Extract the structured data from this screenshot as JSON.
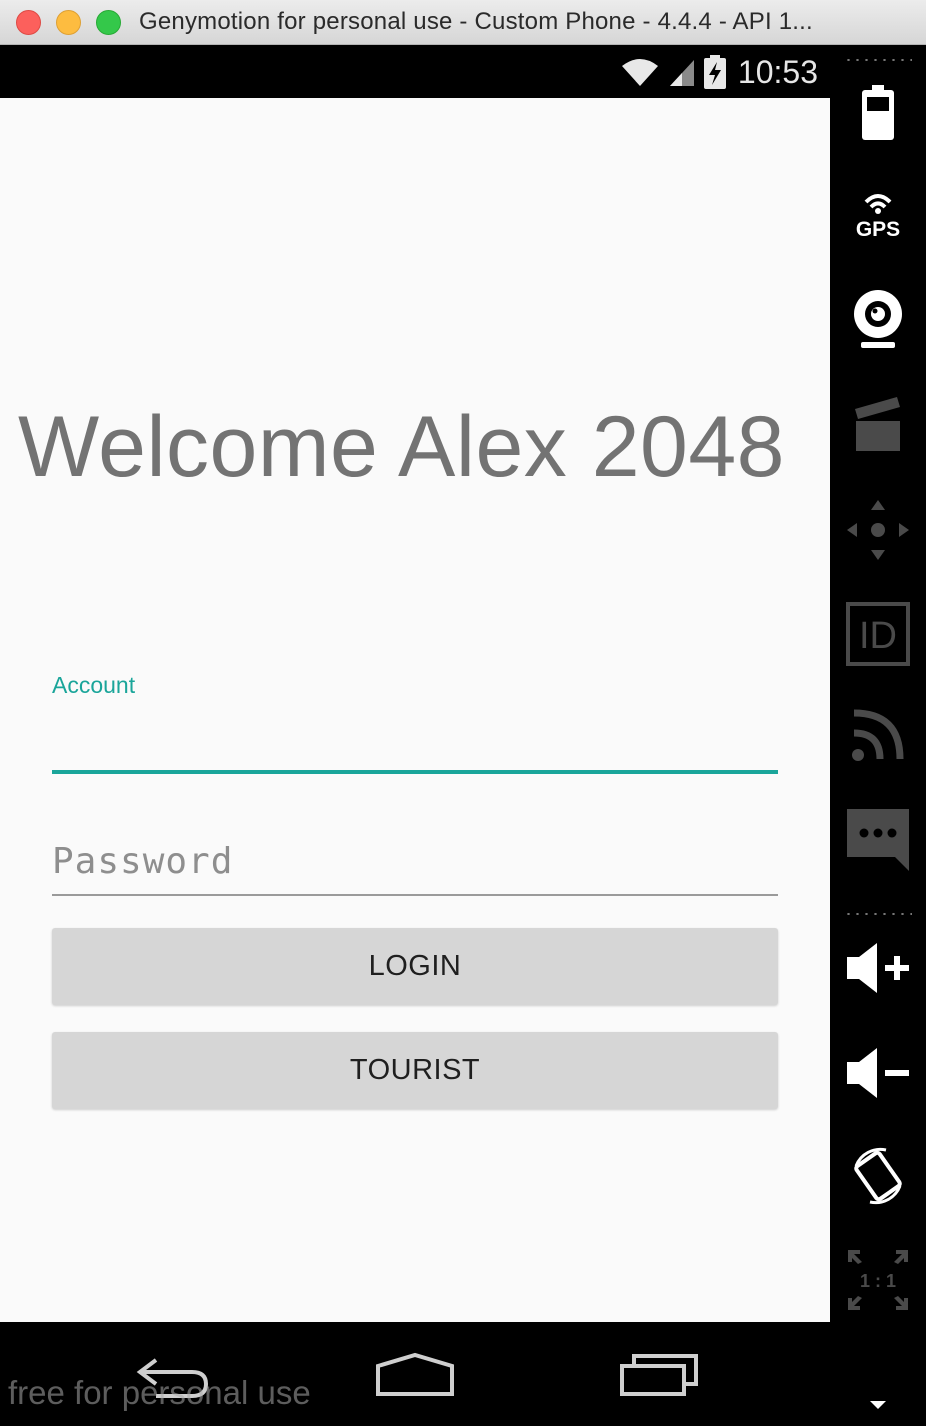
{
  "window": {
    "title": "Genymotion for personal use - Custom Phone - 4.4.4 - API 1..."
  },
  "statusbar": {
    "time": "10:53",
    "icons": [
      "wifi-icon",
      "signal-icon",
      "battery-charging-icon"
    ]
  },
  "app": {
    "welcome_text": "Welcome Alex 2048",
    "account_label": "Account",
    "account_value": "",
    "password_placeholder": "Password",
    "login_label": "LOGIN",
    "tourist_label": "TOURIST"
  },
  "toolbar": {
    "gps_label": "GPS",
    "id_label": "ID",
    "pixel_ratio_label": "1 : 1",
    "items": [
      "battery-icon",
      "gps-icon",
      "webcam-icon",
      "capture-icon",
      "dpad-icon",
      "id-icon",
      "cast-icon",
      "sms-icon",
      "volume-up-icon",
      "volume-down-icon",
      "rotate-icon",
      "pixel-perfect-icon",
      "more-icon"
    ]
  },
  "navbar": {
    "items": [
      "back-icon",
      "home-icon",
      "recents-icon"
    ],
    "watermark": "free for personal use"
  },
  "colors": {
    "accent": "#1aa59a",
    "button_bg": "#d6d6d6",
    "app_bg": "#fafafa",
    "welcome_text": "#737373"
  }
}
